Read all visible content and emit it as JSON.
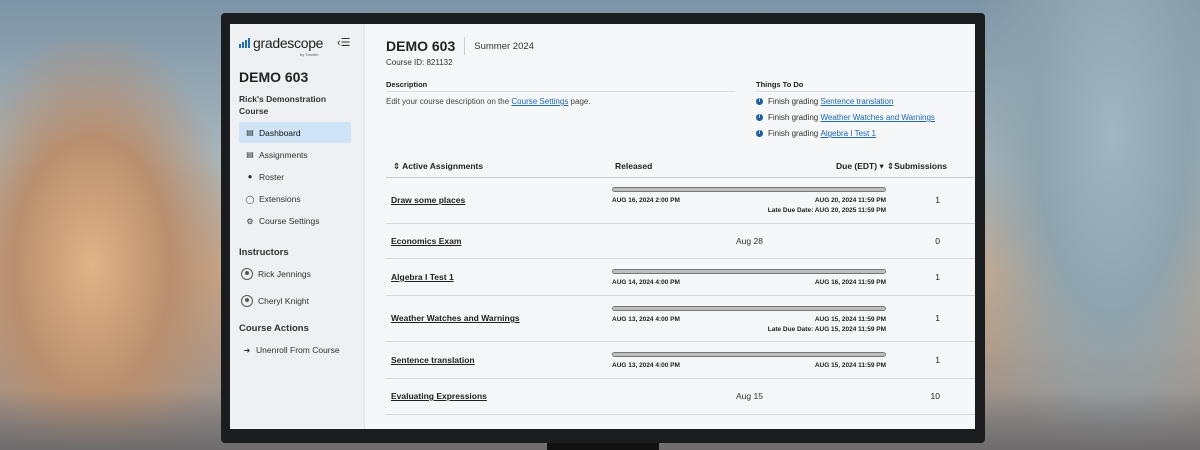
{
  "app": {
    "logo_text": "gradescope",
    "logo_sub": "by Turnitin",
    "accent": "#1f6fb2"
  },
  "sidebar": {
    "course_code": "DEMO 603",
    "course_name": "Rick's Demonstration Course",
    "nav": [
      {
        "label": "Dashboard",
        "icon": "dashboard-icon",
        "active": true
      },
      {
        "label": "Assignments",
        "icon": "document-icon",
        "active": false
      },
      {
        "label": "Roster",
        "icon": "users-icon",
        "active": false
      },
      {
        "label": "Extensions",
        "icon": "clock-icon",
        "active": false
      },
      {
        "label": "Course Settings",
        "icon": "gear-icon",
        "active": false
      }
    ],
    "instructors_heading": "Instructors",
    "instructors": [
      "Rick Jennings",
      "Cheryl Knight"
    ],
    "actions_heading": "Course Actions",
    "actions": [
      {
        "label": "Unenroll From Course",
        "icon": "exit-icon"
      }
    ]
  },
  "header": {
    "title": "DEMO 603",
    "term": "Summer 2024",
    "course_id": "Course ID: 821132"
  },
  "description": {
    "heading": "Description",
    "text_before": "Edit your course description on the ",
    "link": "Course Settings",
    "text_after": " page."
  },
  "todo": {
    "heading": "Things To Do",
    "prefix": "Finish grading",
    "items": [
      "Sentence translation",
      "Weather Watches and Warnings",
      "Algebra I Test 1"
    ]
  },
  "table": {
    "headers": {
      "name": "Active Assignments",
      "released": "Released",
      "due": "Due (EDT)",
      "submissions": "Submissions"
    },
    "rows": [
      {
        "name": "Draw some places",
        "released": "AUG 16, 2024 2:00 PM",
        "due": "AUG 20, 2024 11:59 PM",
        "late": "Late Due Date: AUG 20, 2025 11:59 PM",
        "submissions": "1",
        "progress": 1.0
      },
      {
        "name": "Economics Exam",
        "date": "Aug 28",
        "submissions": "0"
      },
      {
        "name": "Algebra I Test 1",
        "released": "AUG 14, 2024 4:00 PM",
        "due": "AUG 16, 2024 11:59 PM",
        "submissions": "1",
        "progress": 1.0
      },
      {
        "name": "Weather Watches and Warnings",
        "released": "AUG 13, 2024 4:00 PM",
        "due": "AUG 15, 2024 11:59 PM",
        "late": "Late Due Date: AUG 15, 2024 11:59 PM",
        "submissions": "1",
        "progress": 1.0
      },
      {
        "name": "Sentence translation",
        "released": "AUG 13, 2024 4:00 PM",
        "due": "AUG 15, 2024 11:59 PM",
        "submissions": "1",
        "progress": 1.0
      },
      {
        "name": "Evaluating Expressions",
        "date": "Aug 15",
        "submissions": "10"
      }
    ]
  }
}
